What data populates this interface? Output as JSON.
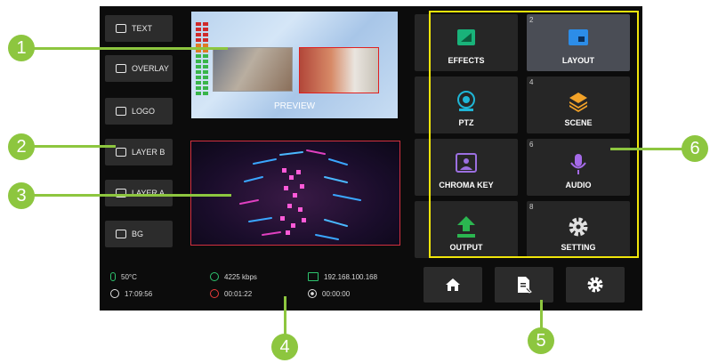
{
  "layers": [
    {
      "label": "TEXT",
      "icon": "text-icon"
    },
    {
      "label": "OVERLAY",
      "icon": "overlay-icon"
    },
    {
      "label": "LOGO",
      "icon": "logo-icon"
    },
    {
      "label": "LAYER B",
      "icon": "layer-b-icon"
    },
    {
      "label": "LAYER A",
      "icon": "layer-a-icon"
    },
    {
      "label": "BG",
      "icon": "image-icon"
    }
  ],
  "preview": {
    "label": "PREVIEW"
  },
  "status": {
    "temperature": "50°C",
    "clock": "17:09:56",
    "bitrate": "4225 kbps",
    "stream_time": "00:01:22",
    "ip": "192.168.100.168",
    "record_time": "00:00:00"
  },
  "tiles": [
    {
      "num": "",
      "label": "EFFECTS",
      "icon": "effects-icon"
    },
    {
      "num": "2",
      "label": "LAYOUT",
      "icon": "layout-icon"
    },
    {
      "num": "",
      "label": "PTZ",
      "icon": "ptz-camera-icon"
    },
    {
      "num": "4",
      "label": "SCENE",
      "icon": "scene-layers-icon"
    },
    {
      "num": "",
      "label": "CHROMA KEY",
      "icon": "chroma-key-icon"
    },
    {
      "num": "6",
      "label": "AUDIO",
      "icon": "microphone-icon"
    },
    {
      "num": "",
      "label": "OUTPUT",
      "icon": "output-upload-icon"
    },
    {
      "num": "8",
      "label": "SETTING",
      "icon": "gear-icon"
    }
  ],
  "bottom_buttons": [
    "home-icon",
    "file-edit-icon",
    "settings-icon"
  ],
  "callouts": [
    "1",
    "2",
    "3",
    "4",
    "5",
    "6"
  ],
  "colors": {
    "callout": "#8dc63f",
    "highlight_box": "#f0e60a",
    "program_border": "#d23040"
  }
}
